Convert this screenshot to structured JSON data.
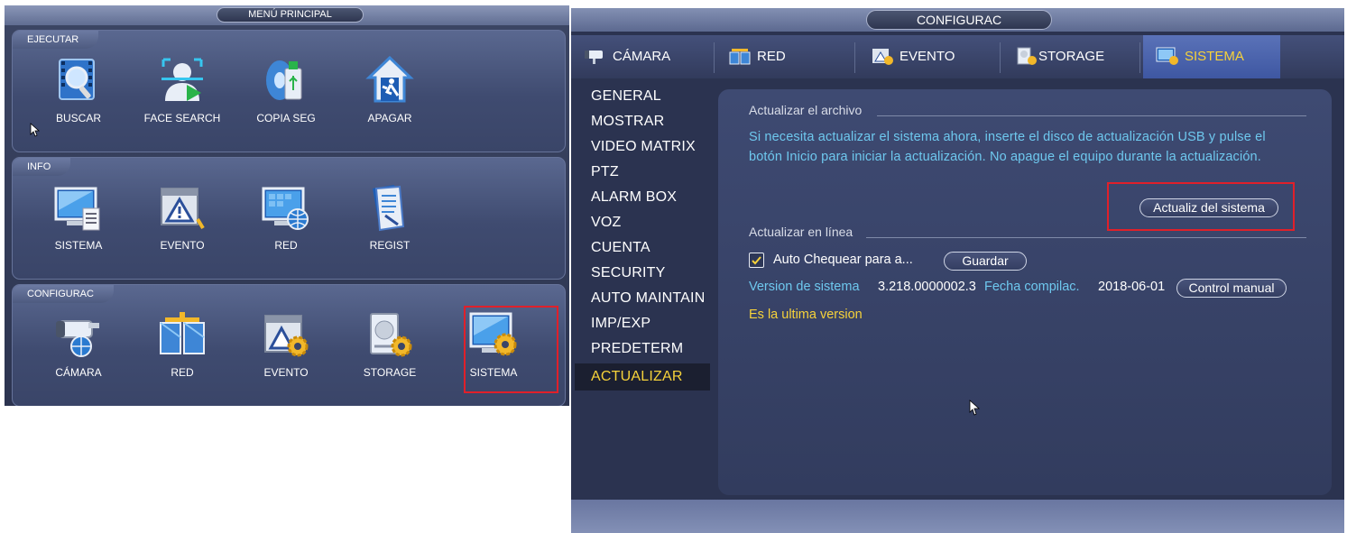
{
  "left_menu": {
    "title": "MENÚ PRINCIPAL",
    "sections": [
      {
        "title": "EJECUTAR",
        "items": [
          {
            "label": "BUSCAR",
            "icon": "search-video-icon"
          },
          {
            "label": "FACE SEARCH",
            "icon": "face-search-icon"
          },
          {
            "label": "COPIA SEG",
            "icon": "backup-usb-icon"
          },
          {
            "label": "APAGAR",
            "icon": "shutdown-house-icon"
          }
        ]
      },
      {
        "title": "INFO",
        "items": [
          {
            "label": "SISTEMA",
            "icon": "monitor-doc-icon"
          },
          {
            "label": "EVENTO",
            "icon": "event-warning-icon"
          },
          {
            "label": "RED",
            "icon": "network-globe-icon"
          },
          {
            "label": "REGIST",
            "icon": "log-book-icon"
          }
        ]
      },
      {
        "title": "CONFIGURAC",
        "items": [
          {
            "label": "CÁMARA",
            "icon": "camera-globe-icon"
          },
          {
            "label": "RED",
            "icon": "network-blocks-icon"
          },
          {
            "label": "EVENTO",
            "icon": "event-gear-icon"
          },
          {
            "label": "STORAGE",
            "icon": "storage-gear-icon"
          },
          {
            "label": "SISTEMA",
            "icon": "system-gear-icon",
            "highlighted": true
          }
        ]
      }
    ]
  },
  "config_window": {
    "title": "CONFIGURAC",
    "tabs": [
      {
        "label": "CÁMARA",
        "icon": "camera-tab-icon"
      },
      {
        "label": "RED",
        "icon": "network-tab-icon"
      },
      {
        "label": "EVENTO",
        "icon": "event-tab-icon"
      },
      {
        "label": "STORAGE",
        "icon": "storage-tab-icon"
      },
      {
        "label": "SISTEMA",
        "icon": "system-tab-icon",
        "active": true
      }
    ],
    "side_menu": [
      "GENERAL",
      "MOSTRAR",
      "VIDEO MATRIX",
      "PTZ",
      "ALARM BOX",
      "VOZ",
      "CUENTA",
      "SECURITY",
      "AUTO MAINTAIN",
      "IMP/EXP",
      "PREDETERM",
      "ACTUALIZAR"
    ],
    "side_menu_active": "ACTUALIZAR",
    "update_file": {
      "heading": "Actualizar el archivo",
      "info_line1": "Si necesita actualizar el sistema ahora, inserte el disco de actualización USB y pulse el",
      "info_line2": "botón Inicio para iniciar la actualización. No apague el equipo durante la actualización.",
      "button": "Actualiz del sistema"
    },
    "online_update": {
      "heading": "Actualizar en línea",
      "auto_check_label": "Auto Chequear para a...",
      "auto_check_checked": true,
      "save_button": "Guardar",
      "version_label": "Version de sistema",
      "version_value": "3.218.0000002.3",
      "build_label": "Fecha compilac.",
      "build_value": "2018-06-01",
      "manual_button": "Control manual",
      "status": "Es la ultima version"
    }
  },
  "colors": {
    "accent_yellow": "#f6d23a",
    "info_blue": "#6ec8ee",
    "highlight_red": "#e0202a"
  }
}
